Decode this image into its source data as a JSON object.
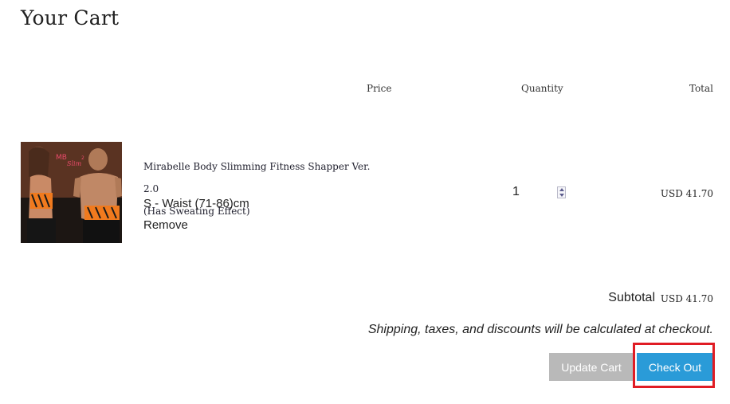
{
  "page": {
    "title": "Your Cart"
  },
  "table_headers": {
    "price": "Price",
    "quantity": "Quantity",
    "total": "Total"
  },
  "cart_item": {
    "name_line1": "Mirabelle Body Slimming Fitness Shapper Ver. 2.0",
    "name_line2": "(Has Sweating Effect)",
    "variant": "S - Waist (71-86)cm",
    "remove_label": "Remove",
    "quantity": "1",
    "line_total": "USD 41.70",
    "image_logo_text": "MB",
    "image_logo_sub": "Slim",
    "image_logo_sup": "2"
  },
  "summary": {
    "subtotal_label": "Subtotal",
    "subtotal_value": "USD 41.70",
    "shipping_note": "Shipping, taxes, and discounts will be calculated at checkout."
  },
  "buttons": {
    "update_cart": "Update Cart",
    "check_out": "Check Out"
  },
  "colors": {
    "checkout_button": "#2a9bd8",
    "update_button": "#b9b9b9",
    "highlight": "#e01c24"
  }
}
